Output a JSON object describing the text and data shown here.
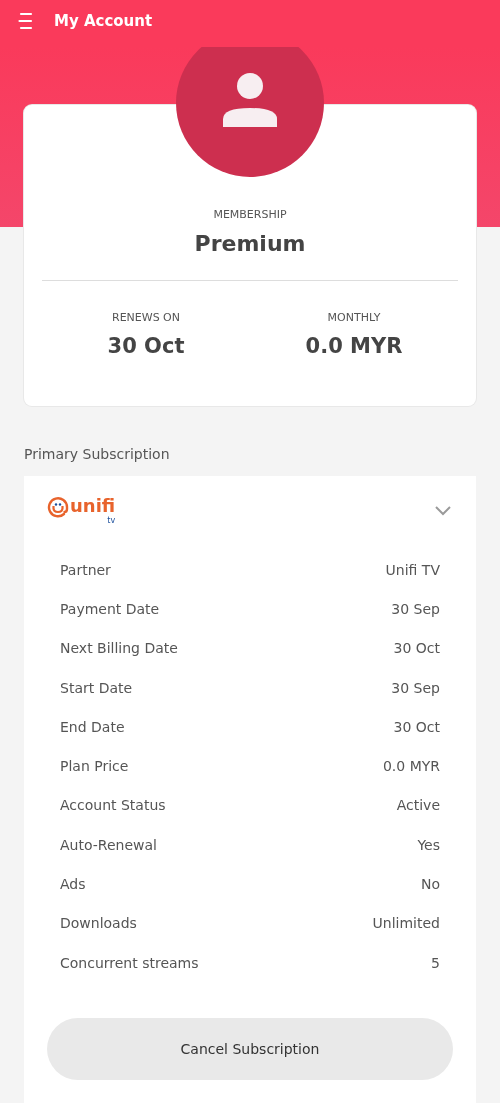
{
  "app_bar": {
    "title": "My Account"
  },
  "membership": {
    "label": "MEMBERSHIP",
    "value": "Premium",
    "stats": [
      {
        "label": "RENEWS ON",
        "value": "30 Oct"
      },
      {
        "label": "MONTHLY",
        "value": "0.0 MYR"
      }
    ]
  },
  "section_title": "Primary Subscription",
  "subscription": {
    "logo_text": "unifi",
    "logo_subtext": "tv",
    "expanded": true,
    "details": [
      {
        "label": "Partner",
        "value": "Unifi TV"
      },
      {
        "label": "Payment Date",
        "value": "30 Sep"
      },
      {
        "label": "Next Billing Date",
        "value": "30 Oct"
      },
      {
        "label": "Start Date",
        "value": "30 Sep"
      },
      {
        "label": "End Date",
        "value": "30 Oct"
      },
      {
        "label": "Plan Price",
        "value": "0.0 MYR"
      },
      {
        "label": "Account Status",
        "value": "Active"
      },
      {
        "label": "Auto-Renewal",
        "value": "Yes"
      },
      {
        "label": "Ads",
        "value": "No"
      },
      {
        "label": "Downloads",
        "value": "Unlimited"
      },
      {
        "label": "Concurrent streams",
        "value": "5"
      }
    ],
    "button": "Cancel Subscription"
  }
}
